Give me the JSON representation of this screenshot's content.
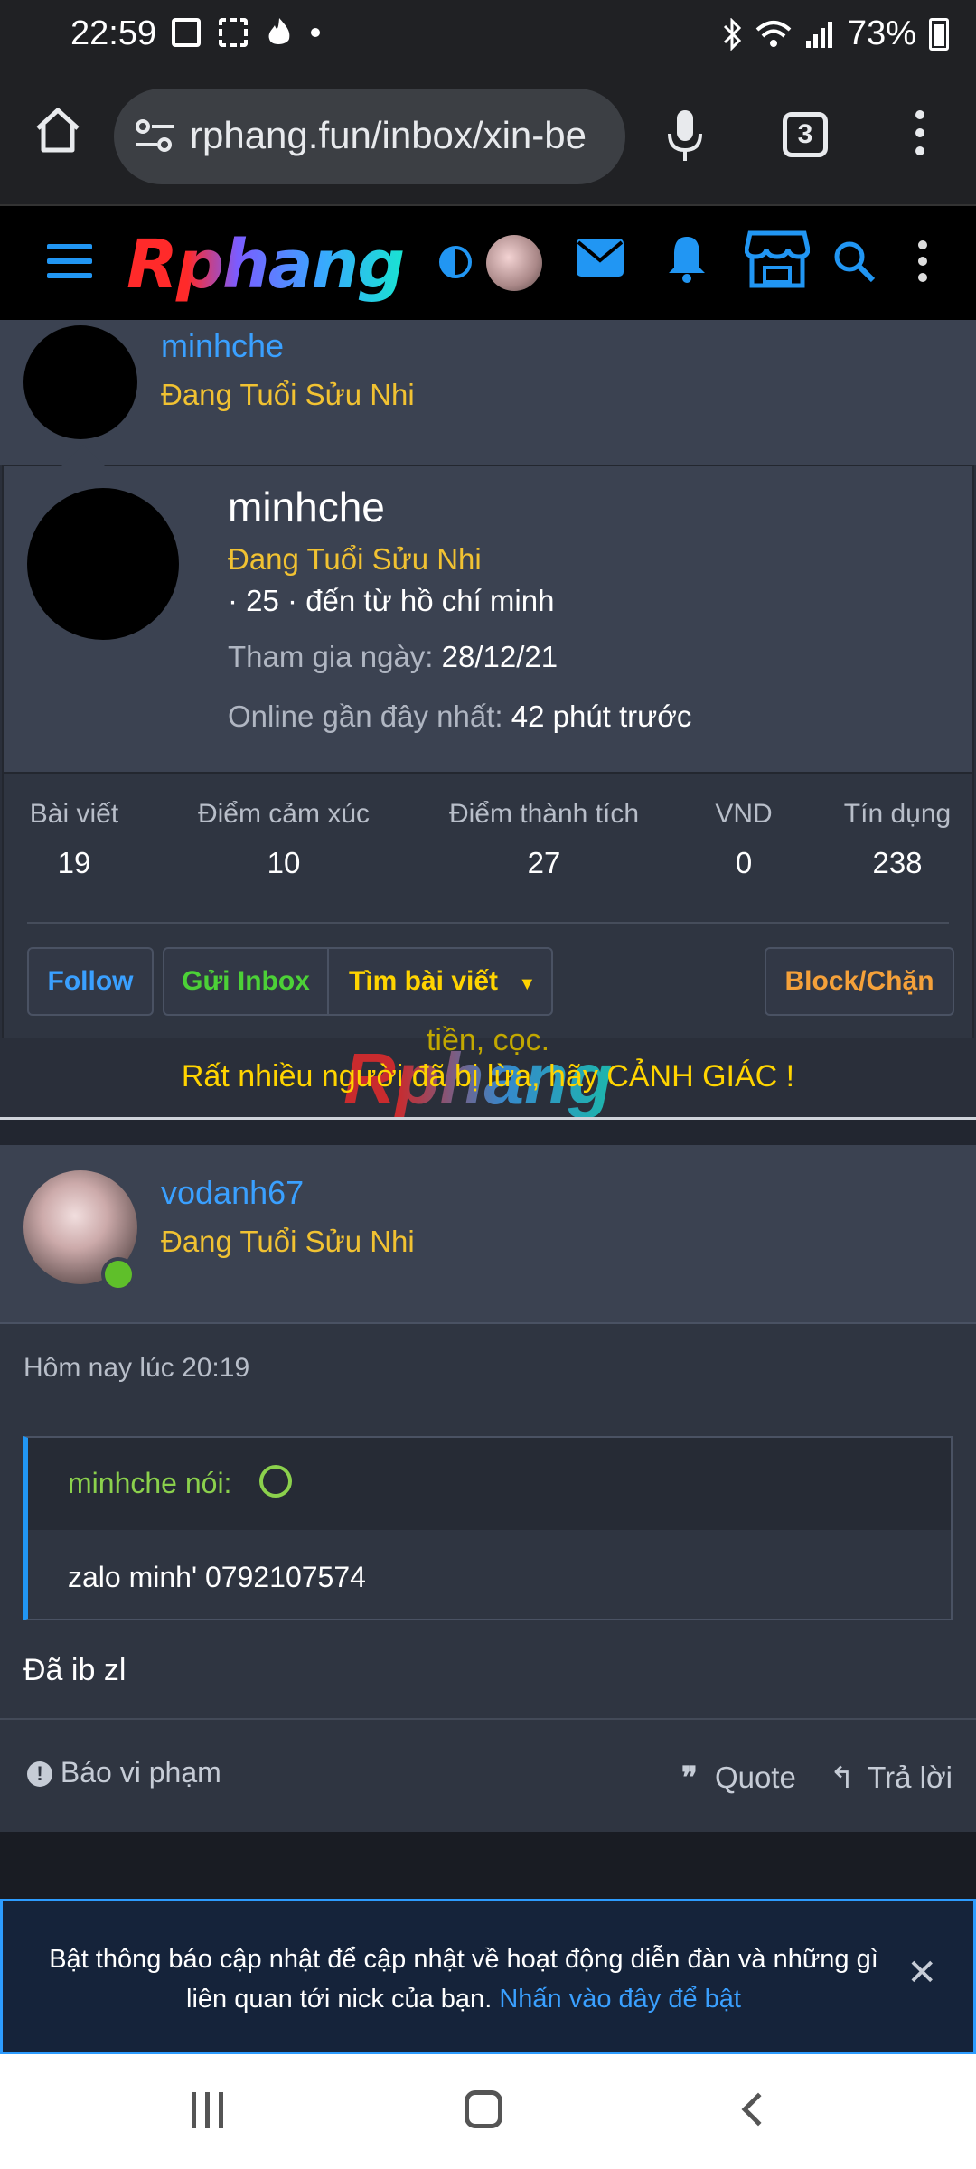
{
  "status_bar": {
    "time": "22:59",
    "battery": "73%"
  },
  "browser": {
    "url": "rphang.fun/inbox/xin-be",
    "tab_count": "3"
  },
  "site": {
    "logo_text": "Rphang",
    "accent": "#2196f3"
  },
  "poster_header": {
    "username": "minhche",
    "user_title": "Đang Tuổi Sửu Nhi"
  },
  "profile_card": {
    "username": "minhche",
    "user_title": "Đang Tuổi Sửu Nhi",
    "meta": "· 25 · đến từ hồ chí minh",
    "joined_label": "Tham gia ngày:",
    "joined_value": "28/12/21",
    "last_seen_label": "Online gần đây nhất:",
    "last_seen_value": "42 phút trước",
    "stats": [
      {
        "label": "Bài viết",
        "value": "19"
      },
      {
        "label": "Điểm cảm xúc",
        "value": "10"
      },
      {
        "label": "Điểm thành tích",
        "value": "27"
      },
      {
        "label": "VND",
        "value": "0"
      },
      {
        "label": "Tín dụng",
        "value": "238"
      }
    ],
    "buttons": {
      "follow": "Follow",
      "send_inbox": "Gửi Inbox",
      "find_posts": "Tìm bài viết",
      "block": "Block/Chặn"
    }
  },
  "notice": {
    "partial": "tiền, cọc.",
    "warning": "Rất nhiều người đã bị lừa, hãy CẢNH GIÁC !"
  },
  "post": {
    "username": "vodanh67",
    "user_title": "Đang Tuổi Sửu Nhi",
    "time": "Hôm nay lúc 20:19",
    "quote_author": "minhche nói:",
    "quote_body": "zalo minh' 0792107574",
    "message": "Đã ib zl",
    "report": "Báo vi phạm",
    "quote": "Quote",
    "reply": "Trả lời"
  },
  "banner": {
    "text": "Bật thông báo cập nhật để cập nhật về hoạt động diễn đàn và những gì liên quan tới nick của bạn.",
    "link": "Nhấn vào đây để bật"
  }
}
